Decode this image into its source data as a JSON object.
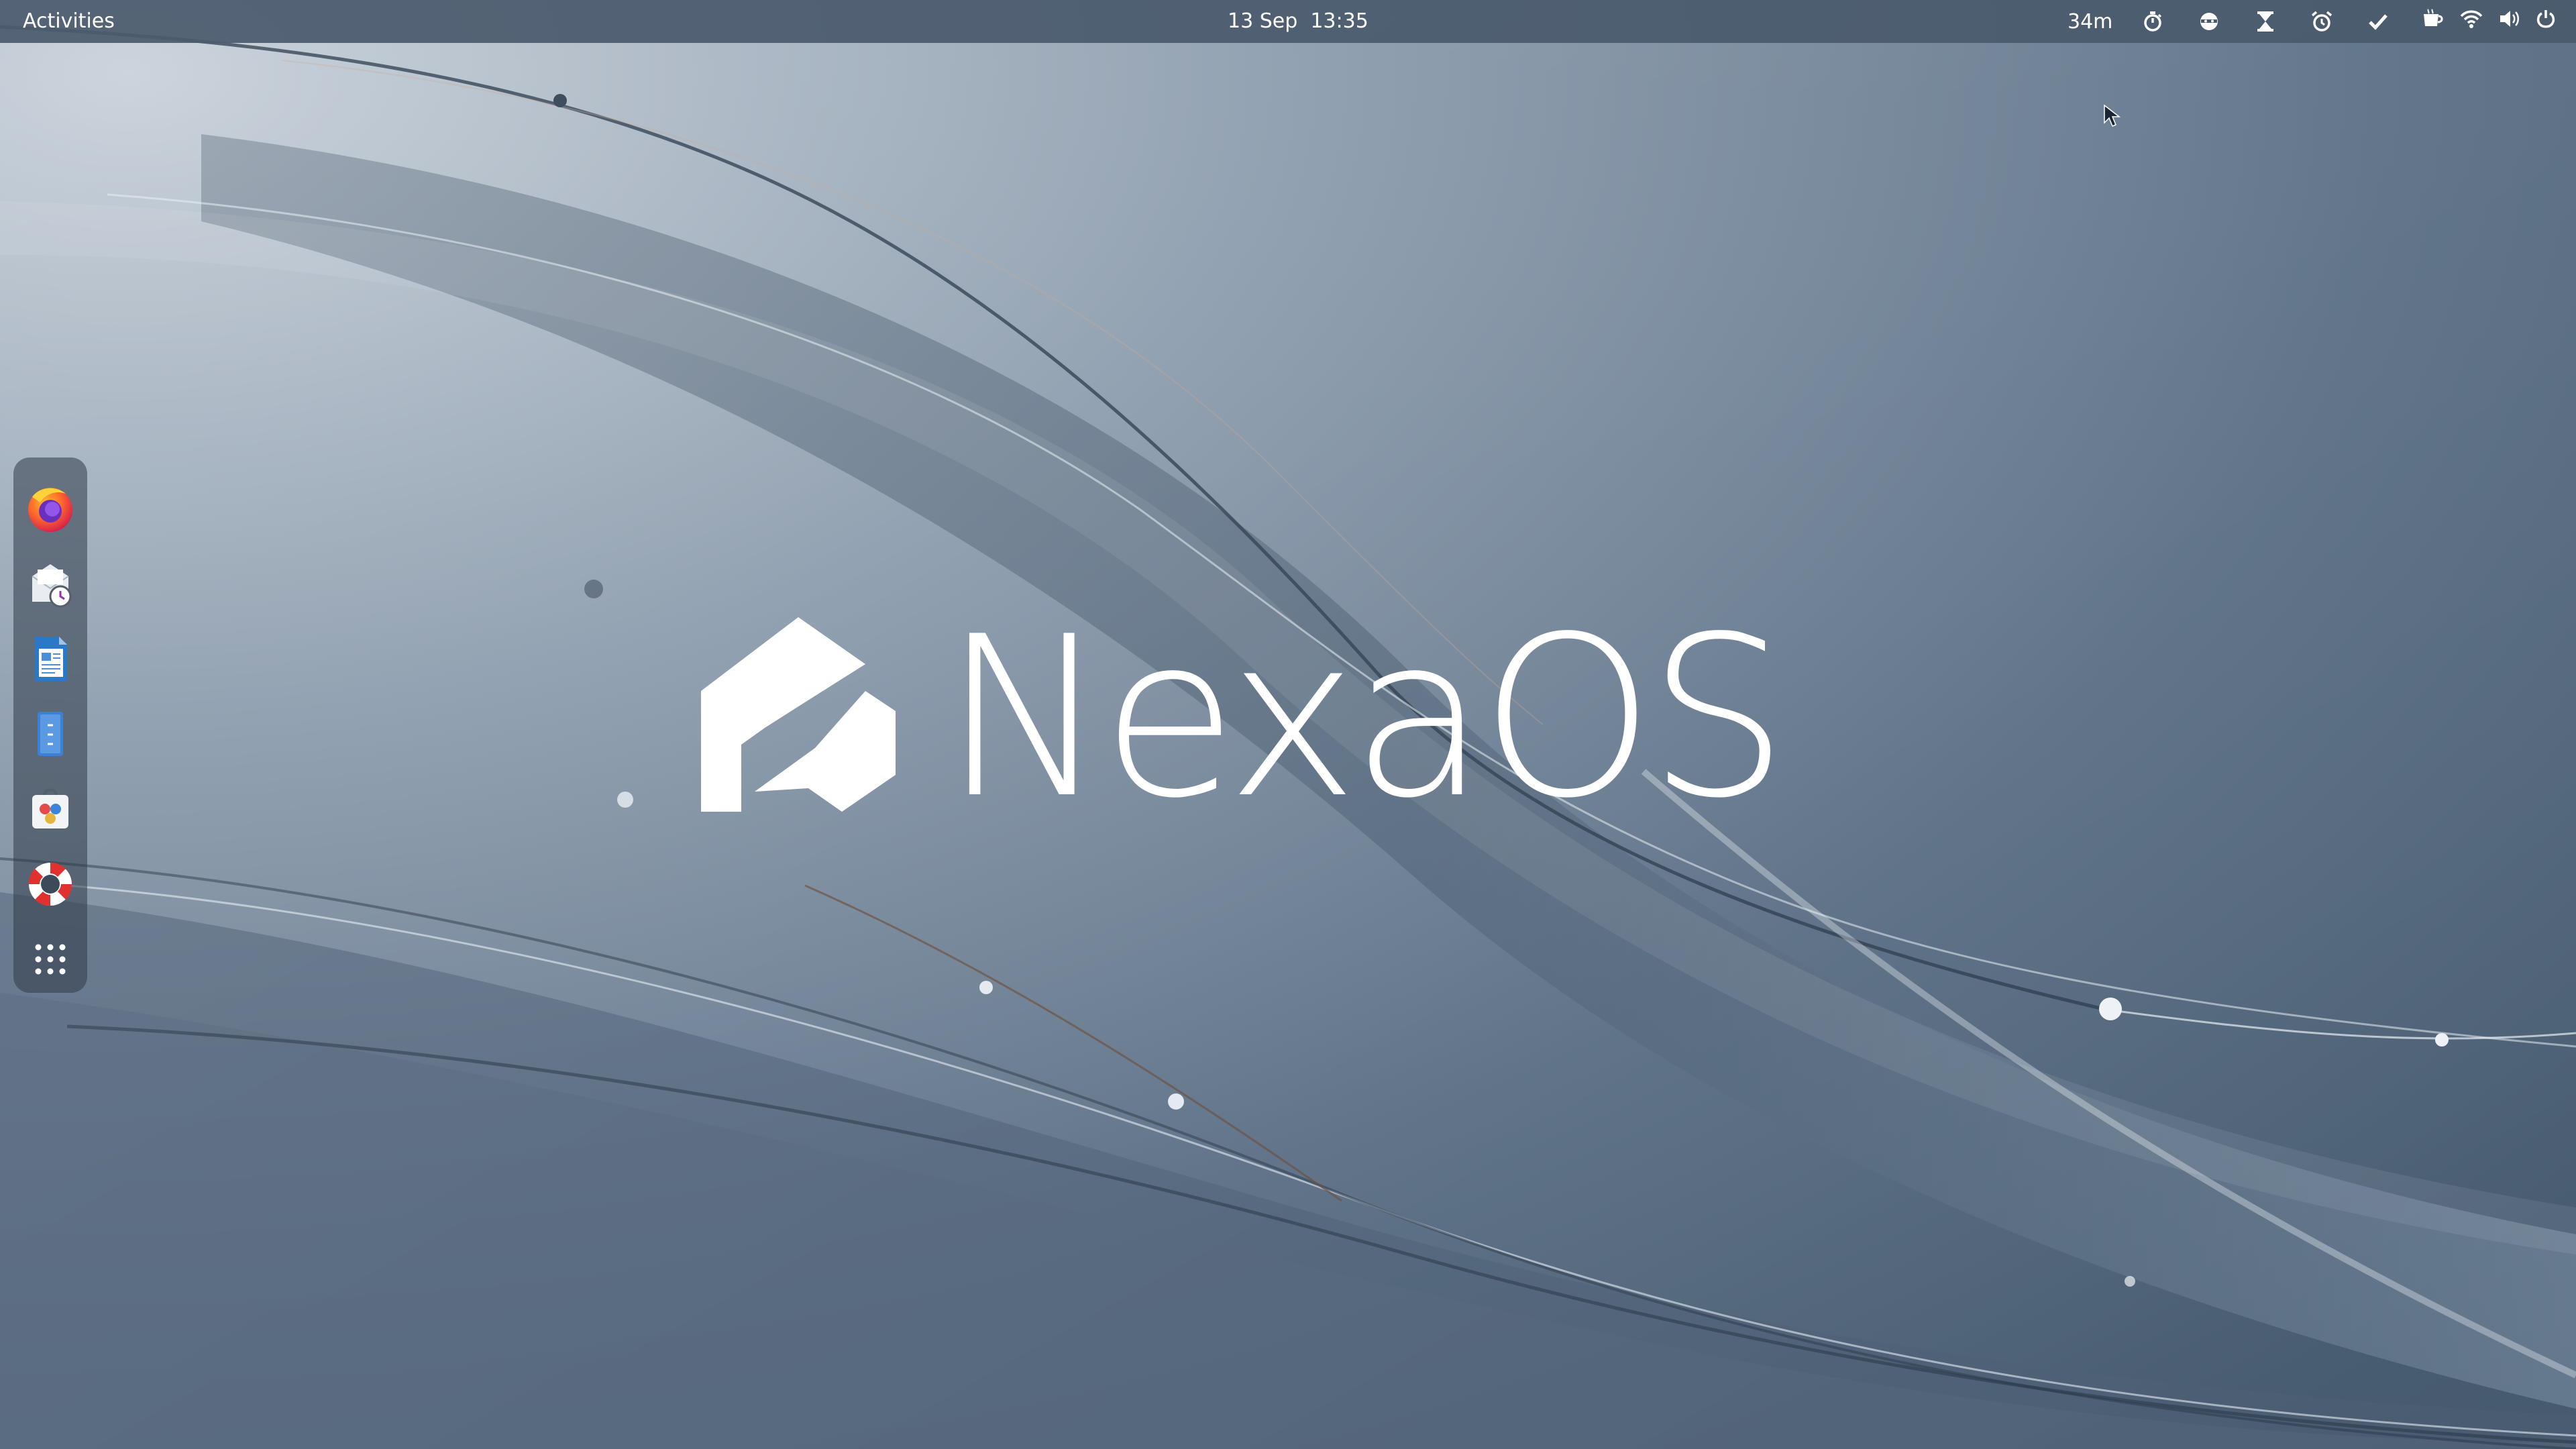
{
  "topbar": {
    "activities_label": "Activities",
    "date": "13 Sep",
    "time": "13:35",
    "timer_remaining": "34m",
    "tray_icons": [
      "stopwatch-icon",
      "user-mask-icon",
      "hourglass-icon",
      "alarm-clock-icon",
      "checkmark-icon"
    ],
    "system_icons": [
      "coffee-cup-icon",
      "wifi-icon",
      "volume-icon",
      "power-icon"
    ]
  },
  "dock": {
    "apps": [
      {
        "name": "Firefox",
        "icon": "firefox-icon"
      },
      {
        "name": "Evolution Mail",
        "icon": "mail-calendar-icon"
      },
      {
        "name": "LibreOffice Writer",
        "icon": "writer-icon"
      },
      {
        "name": "Files",
        "icon": "file-cabinet-icon"
      },
      {
        "name": "Software",
        "icon": "software-store-icon"
      },
      {
        "name": "Help",
        "icon": "lifebuoy-icon"
      },
      {
        "name": "Show Applications",
        "icon": "app-grid-icon"
      }
    ]
  },
  "brand": {
    "name": "NexaOS"
  },
  "colors": {
    "topbar_bg": "#4a5a6c",
    "wallpaper_light": "#c4cdd6",
    "wallpaper_dark": "#4a5d72",
    "text": "#ffffff"
  }
}
